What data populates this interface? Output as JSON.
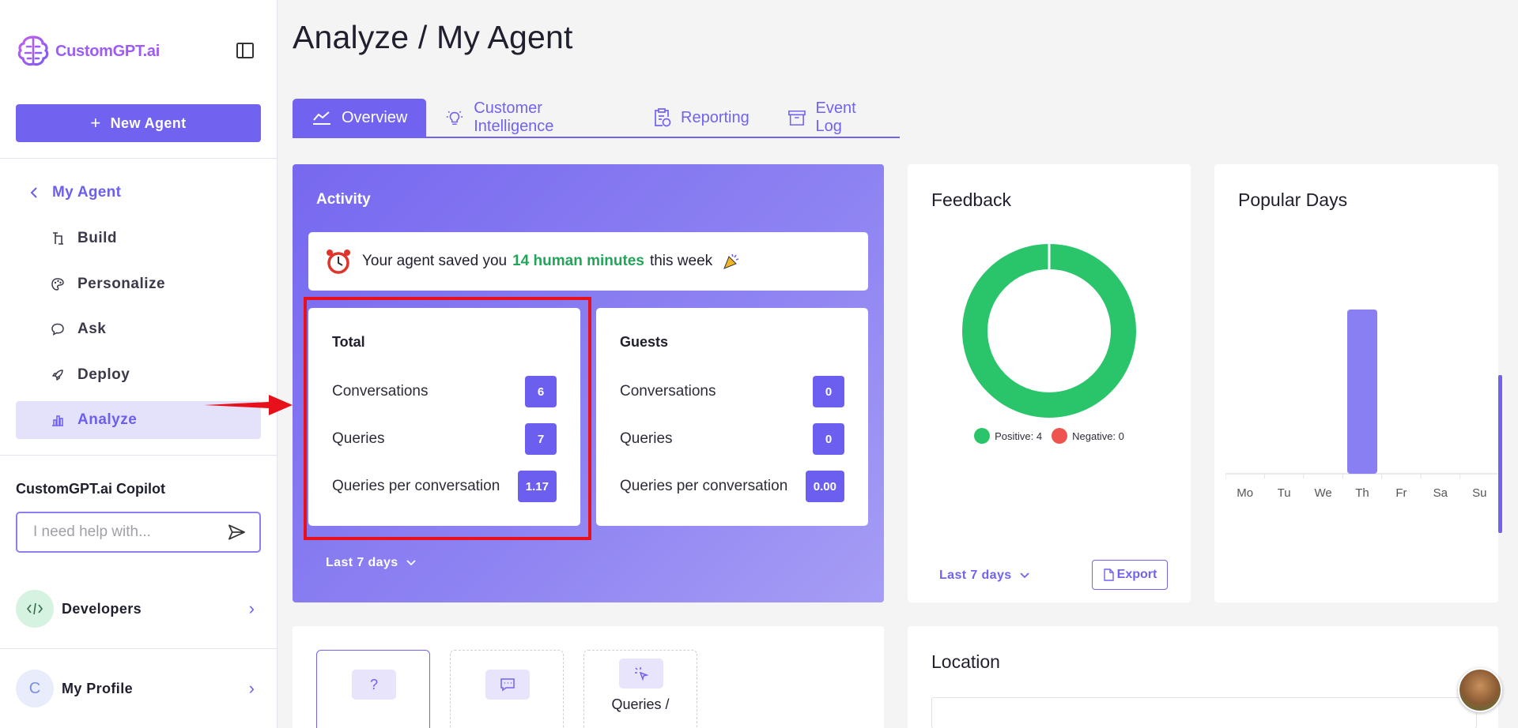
{
  "sidebar": {
    "logo_text": "CustomGPT.ai",
    "new_agent_label": "New Agent",
    "back_label": "My Agent",
    "items": [
      {
        "label": "Build",
        "icon": "build-icon"
      },
      {
        "label": "Personalize",
        "icon": "palette-icon"
      },
      {
        "label": "Ask",
        "icon": "chat-icon"
      },
      {
        "label": "Deploy",
        "icon": "rocket-icon"
      },
      {
        "label": "Analyze",
        "icon": "bar-chart-icon",
        "active": true
      }
    ],
    "copilot_title": "CustomGPT.ai Copilot",
    "copilot_placeholder": "I need help with...",
    "developers_label": "Developers",
    "profile_initial": "C",
    "profile_label": "My Profile"
  },
  "header": {
    "title": "Analyze / My Agent"
  },
  "tabs": [
    {
      "label": "Overview",
      "icon": "line-chart-icon",
      "active": true
    },
    {
      "label": "Customer Intelligence",
      "icon": "lightbulb-icon"
    },
    {
      "label": "Reporting",
      "icon": "clipboard-icon"
    },
    {
      "label": "Event Log",
      "icon": "archive-icon"
    }
  ],
  "activity": {
    "title": "Activity",
    "saved_prefix": "Your agent saved you",
    "saved_highlight": "14 human minutes",
    "saved_suffix": "this week",
    "total": {
      "title": "Total",
      "rows": [
        {
          "label": "Conversations",
          "value": "6"
        },
        {
          "label": "Queries",
          "value": "7"
        },
        {
          "label": "Queries per conversation",
          "value": "1.17"
        }
      ]
    },
    "guests": {
      "title": "Guests",
      "rows": [
        {
          "label": "Conversations",
          "value": "0"
        },
        {
          "label": "Queries",
          "value": "0"
        },
        {
          "label": "Queries per conversation",
          "value": "0.00"
        }
      ]
    },
    "period": "Last 7 days"
  },
  "feedback": {
    "title": "Feedback",
    "positive_label": "Positive: 4",
    "negative_label": "Negative: 0",
    "period": "Last 7 days",
    "export_label": "Export",
    "colors": {
      "positive": "#2ac56b",
      "negative": "#ef5350"
    }
  },
  "popular_days": {
    "title": "Popular Days"
  },
  "chart_data": [
    {
      "type": "pie",
      "title": "Feedback",
      "categories": [
        "Positive",
        "Negative"
      ],
      "values": [
        4,
        0
      ],
      "colors": [
        "#2ac56b",
        "#ef5350"
      ],
      "legend": "bottom"
    },
    {
      "type": "bar",
      "title": "Popular Days",
      "categories": [
        "Mo",
        "Tu",
        "We",
        "Th",
        "Fr",
        "Sa",
        "Su"
      ],
      "values": [
        0,
        0,
        0,
        1,
        0,
        0,
        0
      ],
      "color": "#8a7ff2"
    }
  ],
  "tiles": [
    {
      "label": "",
      "icon": "question-icon",
      "active": true
    },
    {
      "label": "",
      "icon": "message-icon"
    },
    {
      "label": "Queries /",
      "icon": "cursor-click-icon"
    }
  ],
  "location": {
    "title": "Location"
  }
}
